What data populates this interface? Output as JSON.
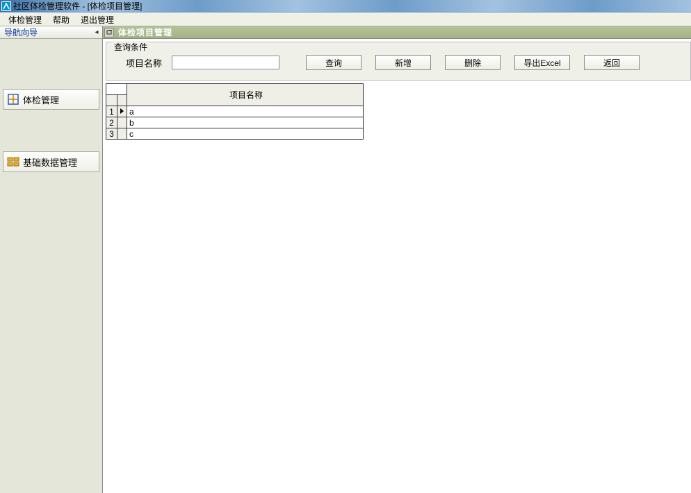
{
  "window": {
    "title": "社区体检管理软件 - [体检项目管理]"
  },
  "menubar": {
    "items": [
      "体检管理",
      "帮助",
      "退出管理"
    ]
  },
  "sidebar": {
    "title": "导航向导",
    "nav": [
      {
        "label": "体检管理",
        "icon": "exam-icon"
      },
      {
        "label": "基础数据管理",
        "icon": "basedata-icon"
      }
    ]
  },
  "content": {
    "title": "体检项目管理",
    "query": {
      "group_label": "查询条件",
      "field_label": "项目名称",
      "field_value": "",
      "buttons": {
        "query": "查询",
        "add": "新增",
        "delete": "删除",
        "export": "导出Excel",
        "back": "返回"
      }
    },
    "grid": {
      "header": "项目名称",
      "rows": [
        {
          "num": "1",
          "marker": true,
          "name": "a"
        },
        {
          "num": "2",
          "marker": false,
          "name": "b"
        },
        {
          "num": "3",
          "marker": false,
          "name": "c"
        }
      ]
    }
  }
}
